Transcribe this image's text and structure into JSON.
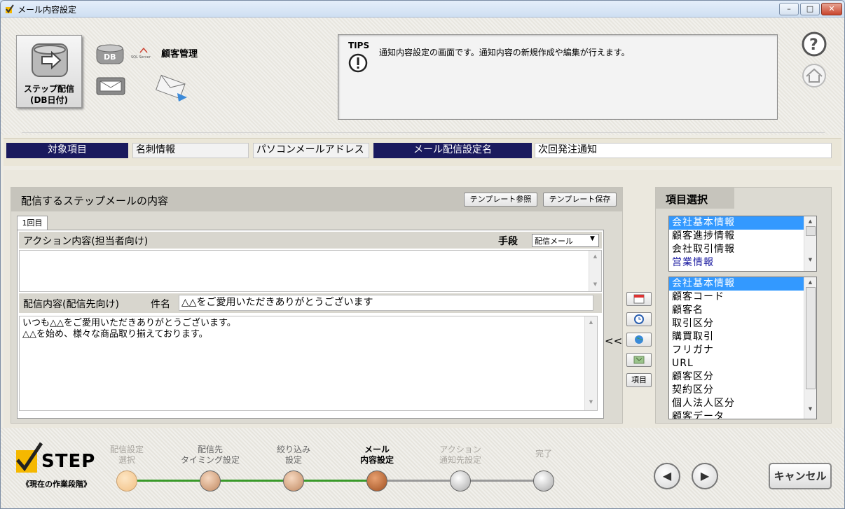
{
  "window": {
    "title": "メール内容設定",
    "min": "–",
    "max": "□",
    "close": "✕"
  },
  "header": {
    "step_button": {
      "line1": "ステップ配信",
      "line2": "(DB日付)"
    },
    "db_label": "DB",
    "sql_label": "SQL Server",
    "customer_mgmt": "顧客管理",
    "tips_label": "TIPS",
    "tips_text": "通知内容設定の画面です。通知内容の新規作成や編集が行えます。",
    "help_icon": "question-circle-icon",
    "home_icon": "home-icon"
  },
  "info_bar": {
    "target_label": "対象項目",
    "target_value": "名刺情報",
    "address_value": "パソコンメールアドレス",
    "mail_setting_label": "メール配信設定名",
    "mail_setting_value": "次回発注通知"
  },
  "main": {
    "title": "配信するステップメールの内容",
    "template_ref": "テンプレート参照",
    "template_save": "テンプレート保存",
    "tab": "1回目",
    "action_label": "アクション内容(担当者向け)",
    "method_label": "手段",
    "method_value": "配信メール",
    "delivery_label": "配信内容(配信先向け)",
    "subject_label": "件名",
    "subject_value": "△△をご愛用いただきありがとうございます",
    "body_line1": "いつも△△をご愛用いただきありがとうございます。",
    "body_line2": "△△を始め、様々な商品取り揃えております。",
    "insert": "<<",
    "item_button": "項目"
  },
  "item_select": {
    "title": "項目選択",
    "categories": [
      "会社基本情報",
      "顧客進捗情報",
      "会社取引情報",
      "営業情報"
    ],
    "fields": [
      "会社基本情報",
      "顧客コード",
      "顧客名",
      "取引区分",
      "購買取引",
      "フリガナ",
      "URL",
      "顧客区分",
      "契約区分",
      "個人法人区分",
      "顧客データ"
    ]
  },
  "footer": {
    "step_text": "STEP",
    "current_stage": "《現在の作業段階》",
    "steps": [
      {
        "l1": "配信設定",
        "l2": "選択"
      },
      {
        "l1": "配信先",
        "l2": "タイミング設定"
      },
      {
        "l1": "絞り込み",
        "l2": "設定"
      },
      {
        "l1": "メール",
        "l2": "内容設定"
      },
      {
        "l1": "アクション",
        "l2": "通知先設定"
      },
      {
        "l1": "完了",
        "l2": ""
      }
    ],
    "prev": "◀",
    "next": "▶",
    "cancel": "キャンセル"
  },
  "colors": {
    "navy": "#1a1a5e",
    "selection": "#3399ff",
    "progress_green": "#3a9a2a"
  }
}
